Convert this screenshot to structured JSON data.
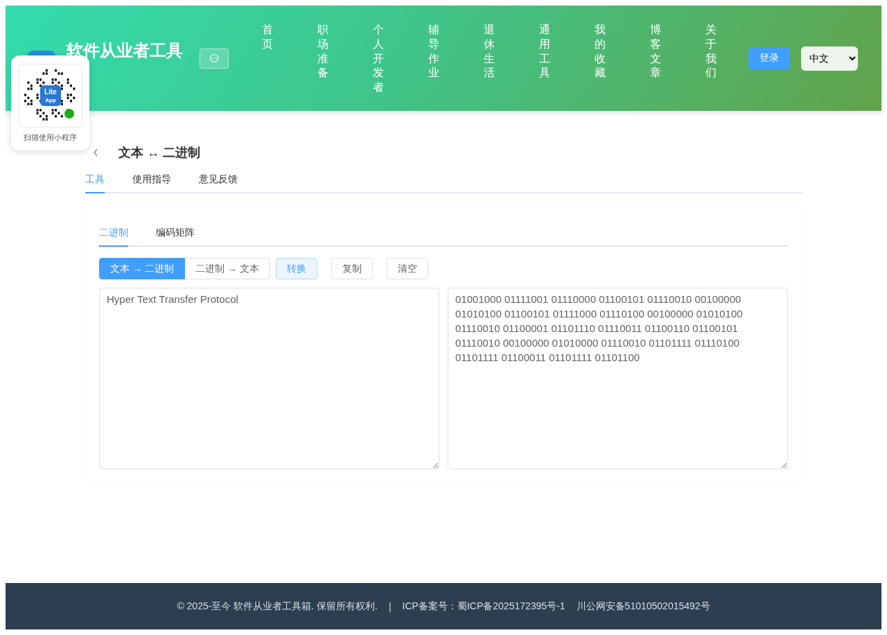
{
  "header": {
    "site_title": "软件从业者工具",
    "nav": [
      {
        "label": "首页"
      },
      {
        "label": "职场准备"
      },
      {
        "label": "个人开发者"
      },
      {
        "label": "辅导作业"
      },
      {
        "label": "退休生活"
      },
      {
        "label": "通用工具"
      },
      {
        "label": "我的收藏"
      },
      {
        "label": "博客文章"
      },
      {
        "label": "关于我们"
      }
    ],
    "login": "登录",
    "language": "中文"
  },
  "qr_popup": {
    "badge_lines": [
      "Lite",
      "App"
    ],
    "caption": "扫描使用小程序"
  },
  "page_title": "文本 ↔ 二进制",
  "tabs": [
    {
      "label": "工具",
      "selected": true
    },
    {
      "label": "使用指导",
      "selected": false
    },
    {
      "label": "意见反馈",
      "selected": false
    }
  ],
  "subtabs": [
    {
      "label": "二进制",
      "selected": true
    },
    {
      "label": "编码矩阵",
      "selected": false
    }
  ],
  "modes": [
    {
      "label": "文本 → 二进制",
      "selected": true
    },
    {
      "label": "二进制 → 文本",
      "selected": false
    }
  ],
  "actions": [
    {
      "label": "转换",
      "kind": "primary"
    },
    {
      "label": "复制",
      "kind": "plain"
    },
    {
      "label": "清空",
      "kind": "plain"
    }
  ],
  "input": "Hyper Text Transfer Protocol",
  "output": "01001000 01111001 01110000 01100101 01110010 00100000 01010100 01100101 01111000 01110100 00100000 01010100 01110010 01100001 01101110 01110011 01100110 01100101 01110010 00100000 01010000 01110010 01101111 01110100 01101111 01100011 01101111 01101100",
  "footer": {
    "copyright": "© 2025-至今 软件从业者工具箱. 保留所有权利.",
    "separator": "|",
    "icp": "ICP备案号：蜀ICP备2025172395号-1",
    "police": "川公网安备51010502015492号"
  }
}
